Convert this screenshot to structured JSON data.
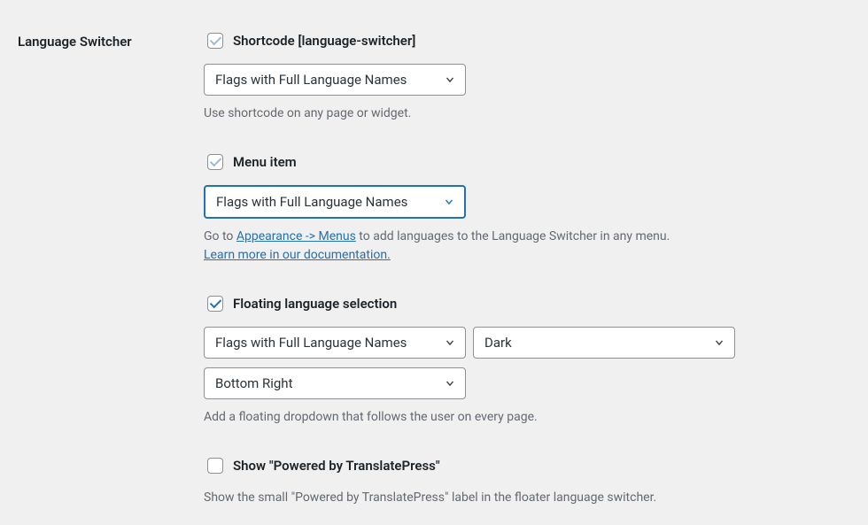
{
  "section": {
    "title": "Language Switcher"
  },
  "shortcode": {
    "checked": true,
    "label": "Shortcode [language-switcher]",
    "select_value": "Flags with Full Language Names",
    "help": "Use shortcode on any page or widget."
  },
  "menu_item": {
    "checked": true,
    "label": "Menu item",
    "select_value": "Flags with Full Language Names",
    "help_prefix": "Go to ",
    "help_link": "Appearance -> Menus",
    "help_suffix": " to add languages to the Language Switcher in any menu. ",
    "doc_link": "Learn more in our documentation."
  },
  "floating": {
    "checked": true,
    "label": "Floating language selection",
    "style_value": "Flags with Full Language Names",
    "theme_value": "Dark",
    "position_value": "Bottom Right",
    "help": "Add a floating dropdown that follows the user on every page."
  },
  "powered": {
    "checked": false,
    "label": "Show \"Powered by TranslatePress\"",
    "help": "Show the small \"Powered by TranslatePress\" label in the floater language switcher."
  }
}
